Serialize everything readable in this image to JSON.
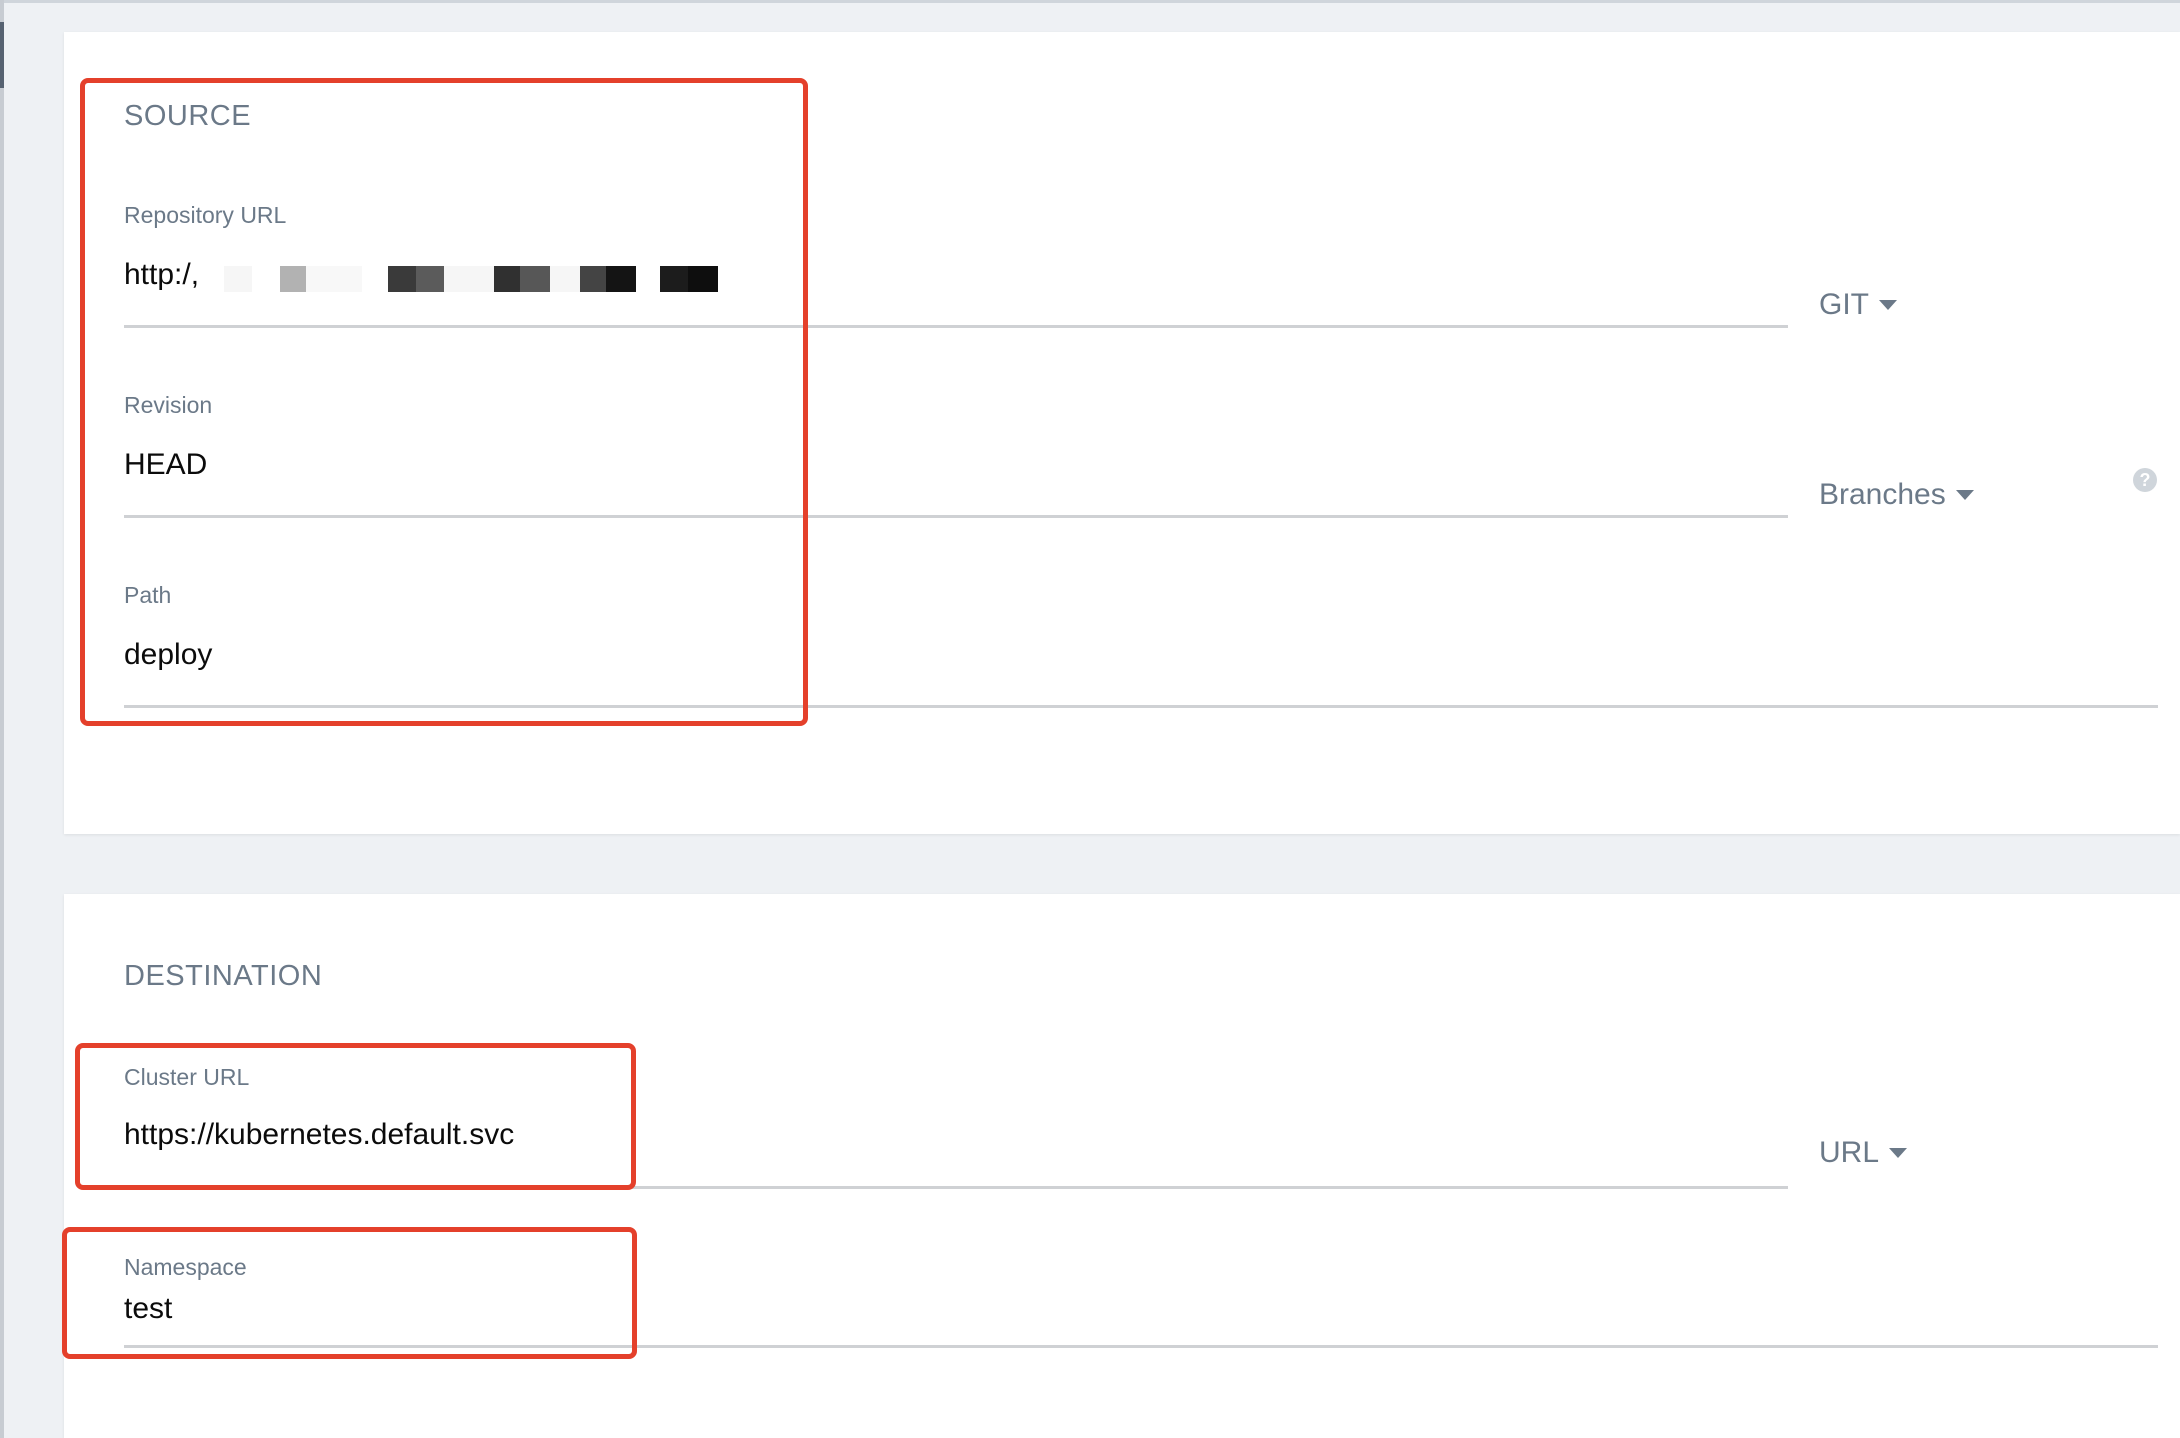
{
  "source": {
    "title": "SOURCE",
    "repository_url": {
      "label": "Repository URL",
      "value": "http:/,",
      "type_dropdown": "GIT"
    },
    "revision": {
      "label": "Revision",
      "value": "HEAD",
      "type_dropdown": "Branches"
    },
    "path": {
      "label": "Path",
      "value": "deploy"
    }
  },
  "destination": {
    "title": "DESTINATION",
    "cluster_url": {
      "label": "Cluster URL",
      "value": "https://kubernetes.default.svc",
      "type_dropdown": "URL"
    },
    "namespace": {
      "label": "Namespace",
      "value": "test"
    }
  },
  "colors": {
    "highlight": "#e4402b",
    "muted_text": "#6b7988",
    "background": "#eef1f4"
  },
  "icons": {
    "help": "question-circle-icon",
    "caret": "caret-down-icon"
  }
}
